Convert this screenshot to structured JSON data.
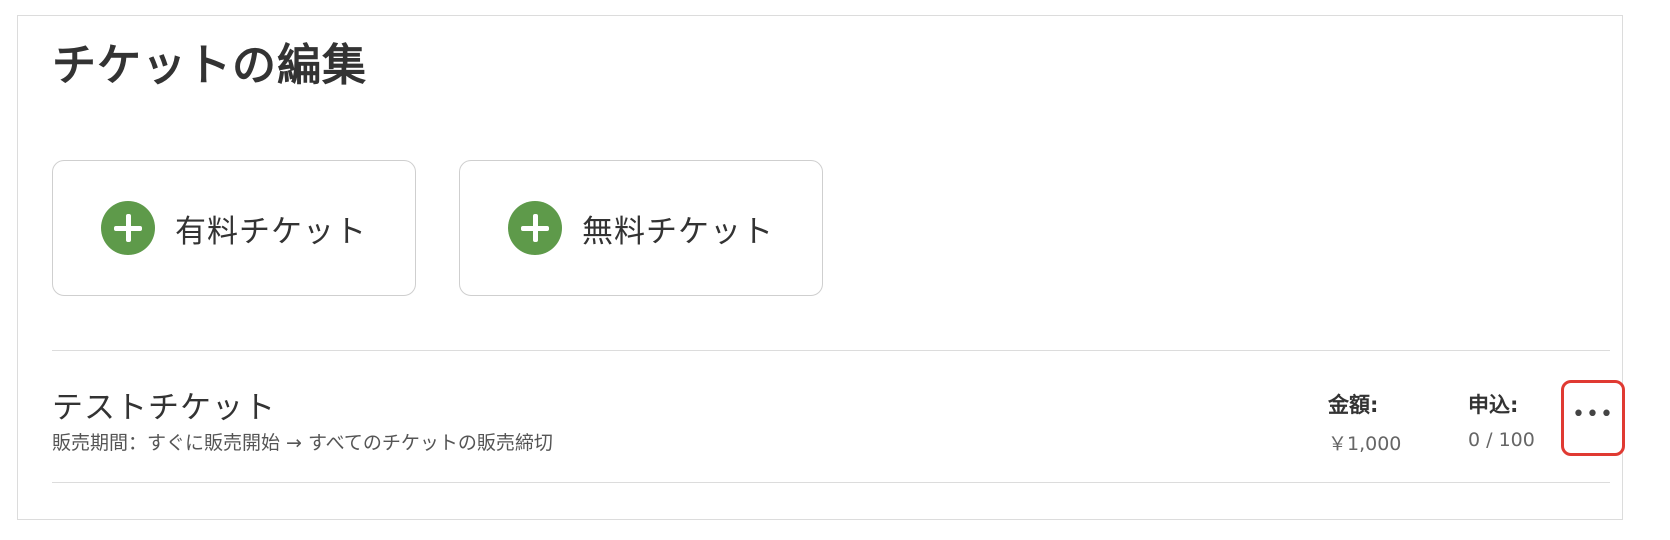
{
  "page": {
    "title": "チケットの編集"
  },
  "actions": {
    "paid_ticket_label": "有料チケット",
    "free_ticket_label": "無料チケット",
    "plus_icon": "plus-circle-icon",
    "accent_color": "#5e9a4a"
  },
  "ticket": {
    "name": "テストチケット",
    "period": "販売期間：すぐに販売開始 → すべてのチケットの販売締切",
    "price_label": "金額:",
    "price_value": "￥1,000",
    "apply_label": "申込:",
    "apply_value": "0 / 100",
    "more_icon": "more-horizontal-icon",
    "more_symbol": "•••",
    "highlight_color": "#e03a32"
  }
}
